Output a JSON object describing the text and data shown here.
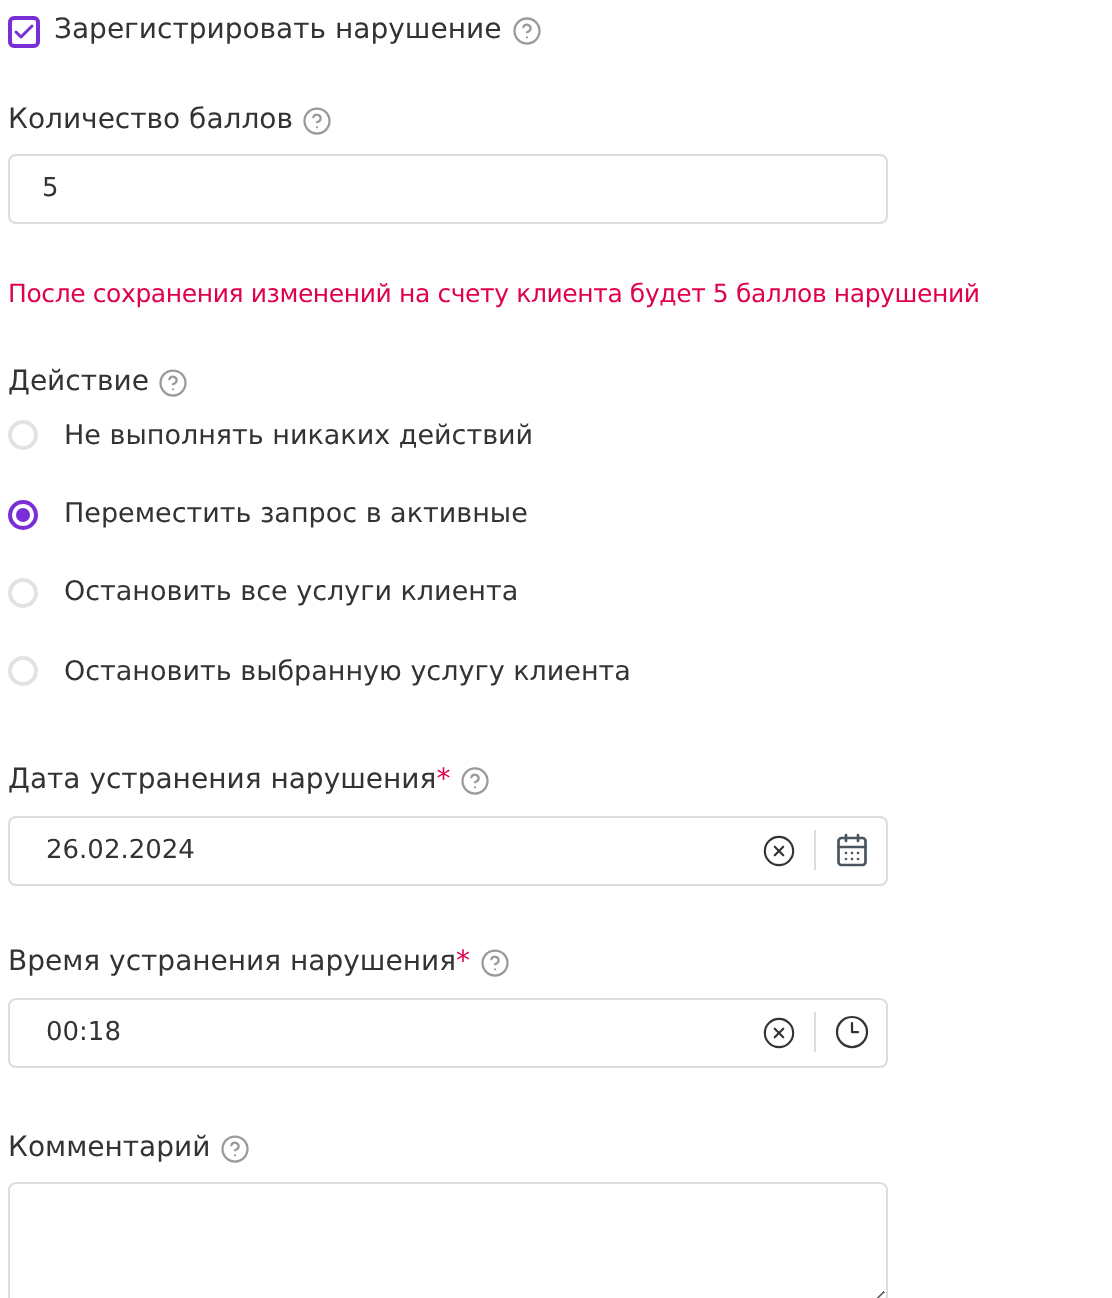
{
  "register": {
    "label": "Зарегистрировать нарушение",
    "checked": true
  },
  "points": {
    "label": "Количество баллов",
    "value": "5"
  },
  "warning": "После сохранения изменений на счету клиента будет 5 баллов нарушений",
  "action": {
    "label": "Действие",
    "options": [
      {
        "label": "Не выполнять никаких действий",
        "selected": false
      },
      {
        "label": "Переместить запрос в активные",
        "selected": true
      },
      {
        "label": "Остановить все услуги клиента",
        "selected": false
      },
      {
        "label": "Остановить выбранную услугу клиента",
        "selected": false
      }
    ]
  },
  "fields": [
    {
      "kind": "date",
      "label": "Дата устранения нарушения",
      "required_mark": "*",
      "value": "26.02.2024"
    },
    {
      "kind": "time",
      "label": "Время устранения нарушения",
      "required_mark": "*",
      "value": "00:18"
    }
  ],
  "comment": {
    "label": "Комментарий"
  }
}
